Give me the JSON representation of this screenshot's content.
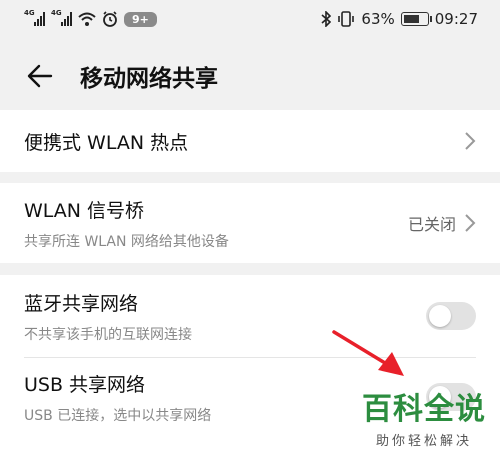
{
  "status_bar": {
    "network_1": "4G",
    "network_2": "4G",
    "notification_badge": "9+",
    "battery": "63%",
    "time": "09:27"
  },
  "header": {
    "title": "移动网络共享"
  },
  "items": [
    {
      "title": "便携式 WLAN 热点"
    },
    {
      "title": "WLAN 信号桥",
      "subtitle": "共享所连 WLAN 网络给其他设备",
      "value": "已关闭"
    },
    {
      "title": "蓝牙共享网络",
      "subtitle": "不共享该手机的互联网连接",
      "enabled": false
    },
    {
      "title": "USB 共享网络",
      "subtitle": "USB 已连接，选中以共享网络",
      "enabled": false
    }
  ],
  "watermark": {
    "main": "百科全说",
    "sub": "助你轻松解决"
  },
  "colors": {
    "background": "#f1f1f1",
    "card": "#ffffff",
    "toggle_off": "#e2e2e2",
    "annotation_arrow": "#e8202a",
    "watermark_green": "#2c8d3f"
  }
}
